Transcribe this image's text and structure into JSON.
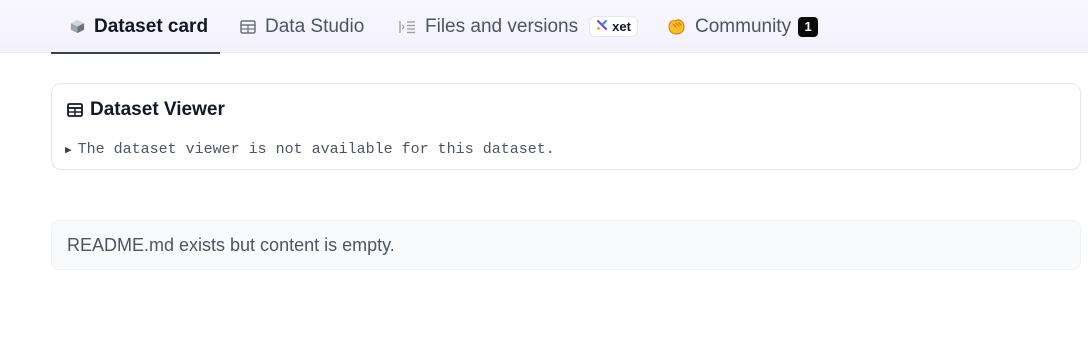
{
  "tabs": [
    {
      "label": "Dataset card",
      "icon": "cube-icon",
      "active": true
    },
    {
      "label": "Data Studio",
      "icon": "table-icon",
      "active": false
    },
    {
      "label": "Files and versions",
      "icon": "files-tree-icon",
      "active": false,
      "badge": "xet"
    },
    {
      "label": "Community",
      "icon": "community-hands-icon",
      "active": false,
      "count": "1"
    }
  ],
  "viewer": {
    "title": "Dataset Viewer",
    "note": "The dataset viewer is not available for this dataset."
  },
  "readme": {
    "message": "README.md exists but content is empty."
  },
  "colors": {
    "tabbar_bg": "#f6f4fe",
    "active_underline": "#374151",
    "xet_accent": "#7c3aed",
    "community_icon": "#f59e0b"
  }
}
